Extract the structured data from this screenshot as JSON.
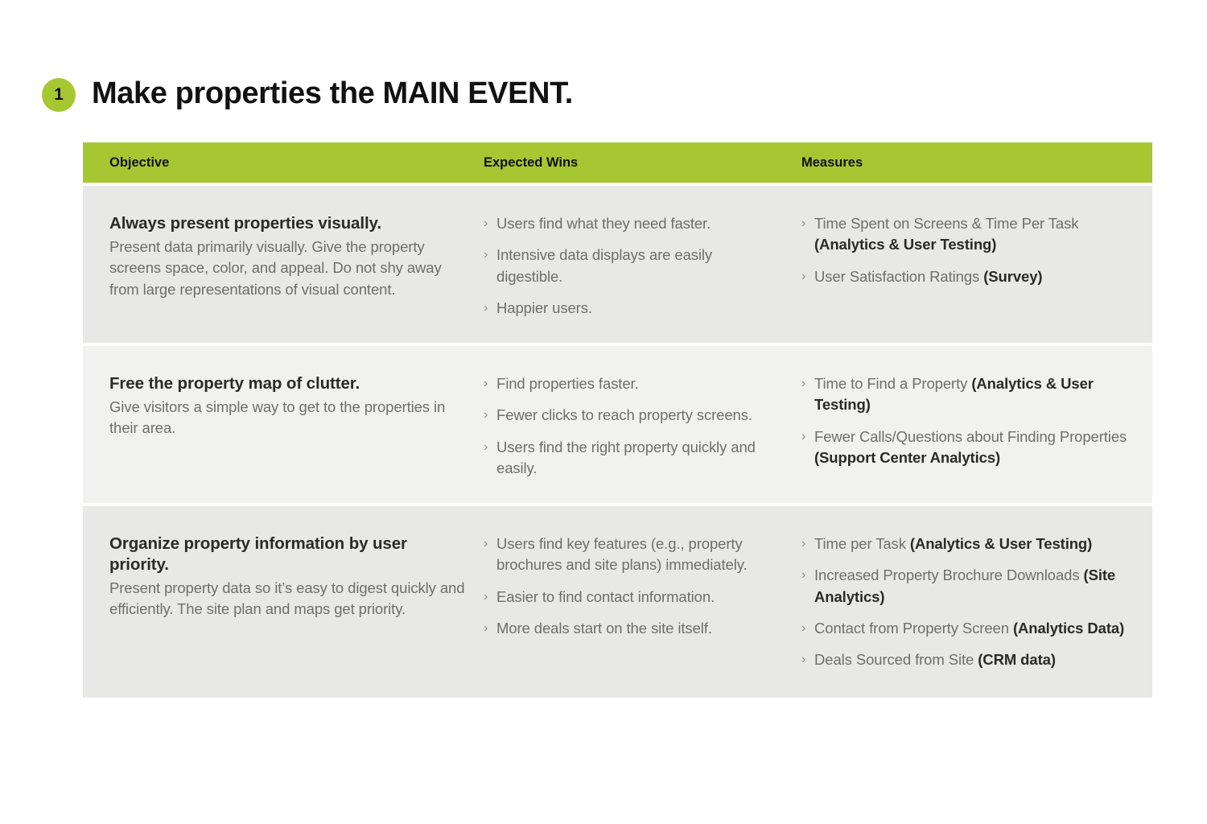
{
  "slide": {
    "number_badge": "1",
    "title": "Make properties the MAIN EVENT.",
    "accent_color": "#a6c732",
    "row_color_a": "#e8e8e6",
    "row_color_b": "#f1f1ef"
  },
  "table": {
    "headers": {
      "objective": "Objective",
      "expected_wins": "Expected Wins",
      "measures": "Measures"
    },
    "rows": [
      {
        "objective_title": "Always present properties visually.",
        "objective_desc": "Present data primarily visually. Give the property screens space, color, and appeal. Do not shy away from large representations of visual content.",
        "expected_wins": [
          {
            "text": "Users find what they need faster.",
            "bold": ""
          },
          {
            "text": "Intensive data displays are easily digestible.",
            "bold": ""
          },
          {
            "text": "Happier users.",
            "bold": ""
          }
        ],
        "measures": [
          {
            "text": "Time Spent on Screens & Time Per Task ",
            "bold": "(Analytics & User Testing)"
          },
          {
            "text": "User Satisfaction Ratings ",
            "bold": "(Survey)"
          }
        ]
      },
      {
        "objective_title": "Free the property map of clutter.",
        "objective_desc": "Give visitors a simple way to get to the properties in their area.",
        "expected_wins": [
          {
            "text": "Find properties faster.",
            "bold": ""
          },
          {
            "text": "Fewer clicks to reach property screens.",
            "bold": ""
          },
          {
            "text": "Users find the right property quickly and easily.",
            "bold": ""
          }
        ],
        "measures": [
          {
            "text": "Time to Find a Property ",
            "bold": "(Analytics & User Testing)"
          },
          {
            "text": "Fewer Calls/Questions about Finding Properties ",
            "bold": "(Support Center Analytics)"
          }
        ]
      },
      {
        "objective_title": "Organize property information by user priority.",
        "objective_desc": "Present property data so it’s easy to digest quickly and efficiently. The site plan and maps get priority.",
        "expected_wins": [
          {
            "text": "Users find key features (e.g., property brochures and site plans) immediately.",
            "bold": ""
          },
          {
            "text": "Easier to find contact information.",
            "bold": ""
          },
          {
            "text": "More deals start on the site itself.",
            "bold": ""
          }
        ],
        "measures": [
          {
            "text": "Time per Task ",
            "bold": "(Analytics & User Testing)"
          },
          {
            "text": "Increased Property Brochure Downloads ",
            "bold": "(Site Analytics)"
          },
          {
            "text": "Contact from Property Screen ",
            "bold": "(Analytics Data)"
          },
          {
            "text": "Deals Sourced from Site ",
            "bold": "(CRM data)"
          }
        ]
      }
    ]
  },
  "icons": {
    "bullet_chevron": "›"
  }
}
